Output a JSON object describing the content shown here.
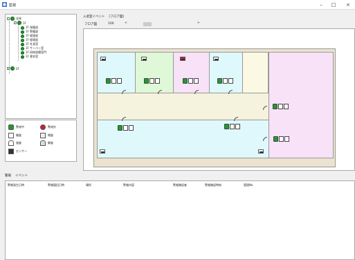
{
  "window": {
    "title": "監視",
    "minimize": "–",
    "maximize": "□",
    "close": "×"
  },
  "tree": {
    "root": "全体",
    "floor1": "1F",
    "rooms": [
      "1F 保健部",
      "1F 警備部",
      "1F 経理部",
      "1F 経理部",
      "1F 社長室",
      "1F サーバー室",
      "1F 研修設備室門",
      "1F 更衣室"
    ],
    "floor2": "2F"
  },
  "legend": {
    "items": [
      {
        "label": "警戒中",
        "icon": "green-status-icon"
      },
      {
        "label": "警戒外",
        "icon": "red-status-icon"
      },
      {
        "label": "開錠",
        "icon": "unlocked-door-icon"
      },
      {
        "label": "閉錠",
        "icon": "locked-door-icon"
      },
      {
        "label": "施錠",
        "icon": "lock-icon"
      },
      {
        "label": "解錠",
        "icon": "unlock-icon"
      },
      {
        "label": "センサー",
        "icon": "sensor-icon"
      }
    ]
  },
  "map_tabs": {
    "tab1": "入退室イベント",
    "tab2": "[フロア図]"
  },
  "map_toolbar": {
    "label": "フロア図",
    "zoom": "100",
    "nav_left": "<",
    "nav_right": ">"
  },
  "bottom_tabs": {
    "tab1": "警報",
    "tab2": "イベント"
  },
  "table": {
    "headers": [
      "警報発生日時",
      "警報復旧日時",
      "場所",
      "警報内容",
      "警報確認者",
      "警報確認時刻",
      "管理No"
    ]
  },
  "colors": {
    "room_cyan": "#dff8fb",
    "room_green": "#dff8d8",
    "room_pink": "#f8e2f8",
    "room_yellow": "#fbf9e3",
    "corridor": "#f5f2dd",
    "alarm_red": "#cc1e2d",
    "status_green": "#1e9c2a"
  }
}
